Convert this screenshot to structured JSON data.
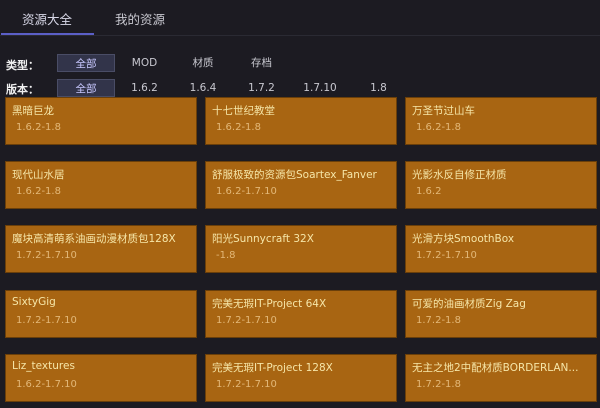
{
  "tabs": [
    {
      "label": "资源大全",
      "active": true
    },
    {
      "label": "我的资源",
      "active": false
    }
  ],
  "filters": {
    "type": {
      "label": "类型：",
      "options": [
        "全部",
        "MOD",
        "材质",
        "存档"
      ],
      "selected": "全部"
    },
    "version": {
      "label": "版本：",
      "options": [
        "全部",
        "1.6.2",
        "1.6.4",
        "1.7.2",
        "1.7.10",
        "1.8"
      ],
      "selected": "全部"
    }
  },
  "resources": [
    {
      "title": "黑暗巨龙",
      "version": "1.6.2-1.8"
    },
    {
      "title": "十七世纪教堂",
      "version": "1.6.2-1.8"
    },
    {
      "title": "万圣节过山车",
      "version": "1.6.2-1.8"
    },
    {
      "title": "现代山水居",
      "version": "1.6.2-1.8"
    },
    {
      "title": "舒服极致的资源包Soartex_Fanver",
      "version": "1.6.2-1.7.10"
    },
    {
      "title": "光影水反自修正材质",
      "version": "1.6.2"
    },
    {
      "title": "魔块高清萌系油画动漫材质包128X",
      "version": "1.7.2-1.7.10"
    },
    {
      "title": "阳光Sunnycraft 32X",
      "version": "-1.8"
    },
    {
      "title": "光滑方块SmoothBox",
      "version": "1.7.2-1.7.10"
    },
    {
      "title": "SixtyGig",
      "version": "1.7.2-1.7.10"
    },
    {
      "title": "完美无瑕IT-Project 64X",
      "version": "1.7.2-1.7.10"
    },
    {
      "title": "可爱的油画材质Zig Zag",
      "version": "1.7.2-1.8"
    },
    {
      "title": "Liz_textures",
      "version": "1.6.2-1.7.10"
    },
    {
      "title": "完美无瑕IT-Project 128X",
      "version": "1.7.2-1.7.10"
    },
    {
      "title": "无主之地2中配材质BORDERLAN...",
      "version": "1.7.2-1.8"
    }
  ],
  "colors": {
    "card": "#a86512",
    "accent": "#5b5fc7",
    "background": "#1c1b22"
  }
}
